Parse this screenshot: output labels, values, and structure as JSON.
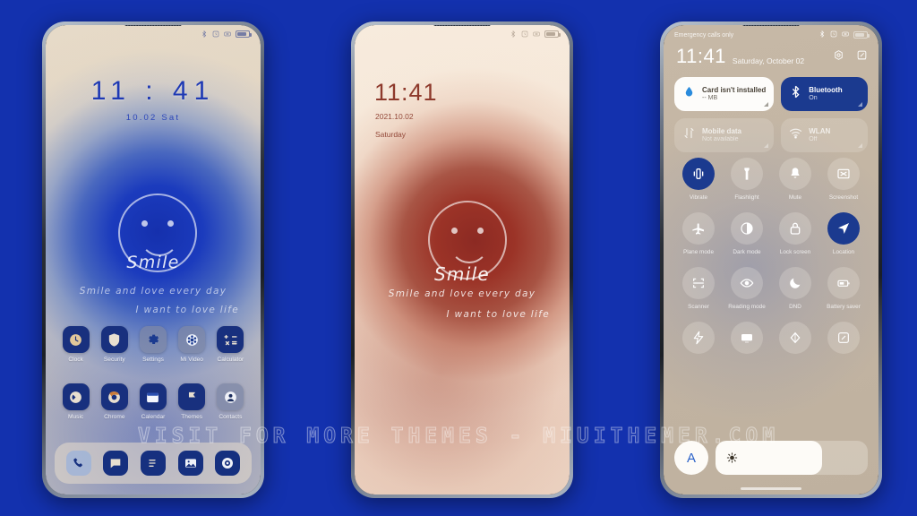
{
  "background_color": "#1331ae",
  "watermark": "VISIT FOR MORE THEMES - MIUITHEMER.COM",
  "phone1": {
    "name": "home-screen-blue",
    "statusbar": {
      "icons": [
        "bluetooth-icon",
        "alarm-icon",
        "silent-icon",
        "battery-icon"
      ]
    },
    "clock": "11 : 41",
    "date": "10.02   Sat",
    "wallpaper": {
      "smile_word": "Smile",
      "line1": "Smile and love every day",
      "line2": "I want to love life",
      "face": "smiley-face"
    },
    "apps_row1": [
      {
        "label": "Clock",
        "icon": "clock-icon",
        "dim": false
      },
      {
        "label": "Security",
        "icon": "shield-icon",
        "dim": false
      },
      {
        "label": "Settings",
        "icon": "gear-icon",
        "dim": true
      },
      {
        "label": "Mi Video",
        "icon": "video-icon",
        "dim": true
      },
      {
        "label": "Calculator",
        "icon": "calculator-icon",
        "dim": false
      }
    ],
    "apps_row2": [
      {
        "label": "Music",
        "icon": "music-icon",
        "dim": false
      },
      {
        "label": "Chrome",
        "icon": "chrome-icon",
        "dim": false
      },
      {
        "label": "Calendar",
        "icon": "calendar-icon",
        "dim": false
      },
      {
        "label": "Themes",
        "icon": "themes-icon",
        "dim": false
      },
      {
        "label": "Contacts",
        "icon": "contacts-icon",
        "dim": true
      }
    ],
    "dock": [
      {
        "label": "Phone",
        "icon": "phone-icon",
        "light": true
      },
      {
        "label": "Messages",
        "icon": "message-icon",
        "light": false
      },
      {
        "label": "Notes",
        "icon": "notes-icon",
        "light": false
      },
      {
        "label": "Gallery",
        "icon": "gallery-icon",
        "light": false
      },
      {
        "label": "Camera",
        "icon": "camera-icon",
        "light": false
      }
    ]
  },
  "phone2": {
    "name": "lock-screen-red",
    "statusbar": {
      "icons": [
        "bluetooth-icon",
        "alarm-icon",
        "silent-icon",
        "battery-icon"
      ]
    },
    "clock": "11:41",
    "date": "2021.10.02",
    "day": "Saturday",
    "wallpaper": {
      "smile_word": "Smile",
      "line1": "Smile and love every day",
      "line2": "I want to love life",
      "face": "smiley-face"
    }
  },
  "phone3": {
    "name": "control-center",
    "carrier": "Emergency calls only",
    "statusbar": {
      "icons": [
        "bluetooth-icon",
        "alarm-icon",
        "silent-icon",
        "battery-icon"
      ]
    },
    "time": "11:41",
    "date": "Saturday, October 02",
    "header_icons": [
      "settings-icon",
      "edit-icon"
    ],
    "big_tiles": [
      {
        "title": "Card isn't installed",
        "sub": "-- MB",
        "icon": "data-usage-icon",
        "state": "on-white"
      },
      {
        "title": "Bluetooth",
        "sub": "On",
        "icon": "bluetooth-icon",
        "state": "on-blue"
      },
      {
        "title": "Mobile data",
        "sub": "Not available",
        "icon": "mobile-data-icon",
        "state": "off"
      },
      {
        "title": "WLAN",
        "sub": "Off",
        "icon": "wifi-icon",
        "state": "off"
      }
    ],
    "toggles": [
      {
        "label": "Vibrate",
        "icon": "vibrate-icon",
        "active": true
      },
      {
        "label": "Flashlight",
        "icon": "flashlight-icon",
        "active": false
      },
      {
        "label": "Mute",
        "icon": "bell-icon",
        "active": false
      },
      {
        "label": "Screenshot",
        "icon": "screenshot-icon",
        "active": false
      },
      {
        "label": "Plane mode",
        "icon": "airplane-icon",
        "active": false
      },
      {
        "label": "Dark mode",
        "icon": "contrast-icon",
        "active": false
      },
      {
        "label": "Lock screen",
        "icon": "lock-icon",
        "active": false
      },
      {
        "label": "Location",
        "icon": "location-icon",
        "active": true
      },
      {
        "label": "Scanner",
        "icon": "scanner-icon",
        "active": false
      },
      {
        "label": "Reading mode",
        "icon": "eye-icon",
        "active": false
      },
      {
        "label": "DND",
        "icon": "moon-icon",
        "active": false
      },
      {
        "label": "Battery saver",
        "icon": "battery-icon",
        "active": false
      },
      {
        "label": "",
        "icon": "flash-icon",
        "active": false
      },
      {
        "label": "",
        "icon": "cast-icon",
        "active": false
      },
      {
        "label": "",
        "icon": "sync-icon",
        "active": false
      },
      {
        "label": "",
        "icon": "edit-icon",
        "active": false
      }
    ],
    "brightness": {
      "auto_label": "A",
      "level_percent": 70,
      "icon": "sun-icon"
    }
  }
}
